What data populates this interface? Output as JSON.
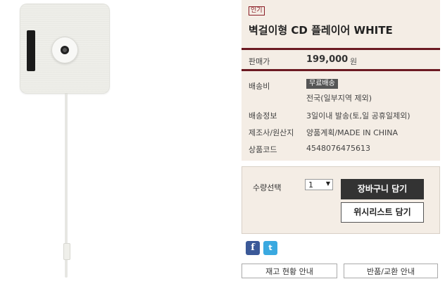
{
  "product": {
    "badge": "인기",
    "title": "벽걸이형 CD 플레이어 WHITE"
  },
  "price": {
    "label": "판매가",
    "value": "199,000",
    "unit": "원"
  },
  "shipping": {
    "label": "배송비",
    "badge": "무료배송",
    "note": "전국(일부지역 제외)"
  },
  "delivery_info": {
    "label": "배송정보",
    "value": "3일이내 발송(토,일 공휴일제외)"
  },
  "origin": {
    "label": "제조사/원산지",
    "value": "양품계획/MADE IN CHINA"
  },
  "product_code": {
    "label": "상품코드",
    "value": "4548076475613"
  },
  "quantity": {
    "label": "수량선택",
    "selected": "1"
  },
  "actions": {
    "cart_label": "장바구니 담기",
    "wishlist_label": "위시리스트 담기",
    "stock_label": "재고 현황 안내",
    "return_label": "반품/교환 안내"
  },
  "social": {
    "facebook_glyph": "f",
    "twitter_glyph": "t"
  },
  "colors": {
    "accent": "#6c1a22",
    "panel_bg": "#f4ede5",
    "cart_button": "#333333"
  }
}
